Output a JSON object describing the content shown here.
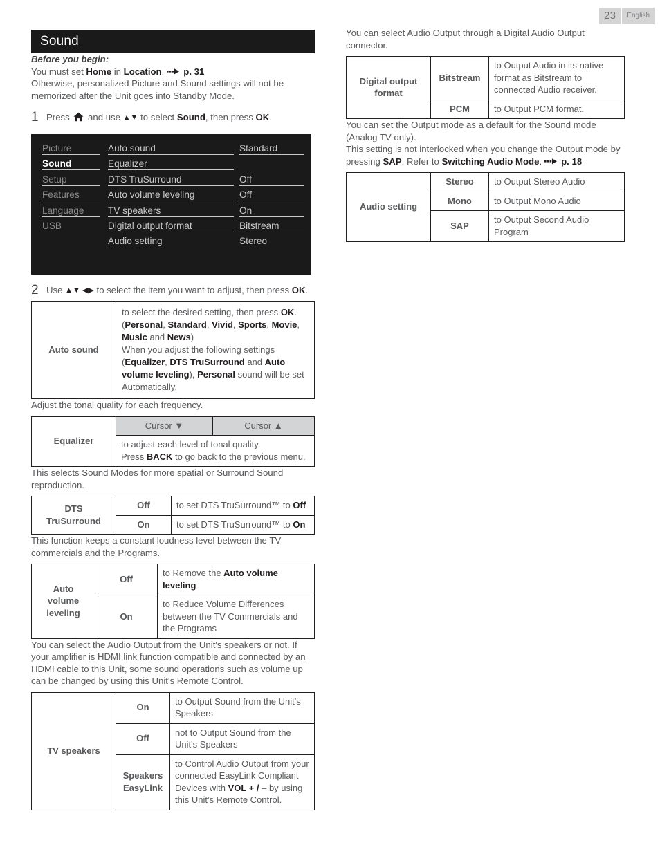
{
  "header": {
    "page_number": "23",
    "language": "English"
  },
  "left": {
    "section_title": "Sound",
    "before_you_begin_label": "Before you begin:",
    "line_home_prefix": "You must set ",
    "line_home_bold1": "Home",
    "line_home_mid": " in ",
    "line_home_bold2": "Location",
    "line_home_dot": ".",
    "line_home_ref": "p. 31",
    "otherwise": "Otherwise, personalized Picture and Sound settings will not be memorized after the Unit goes into Standby Mode.",
    "step1": {
      "number": "1",
      "pre": "Press ",
      "mid": " and use ",
      "arrows": "▲▼",
      "post": " to select ",
      "bold_item": "Sound",
      "tail": ", then press ",
      "bold_ok": "OK",
      "end": "."
    },
    "osd": {
      "menu_items": [
        {
          "label": "Picture",
          "selected": false
        },
        {
          "label": "Sound",
          "selected": true
        },
        {
          "label": "Setup",
          "selected": false
        },
        {
          "label": "Features",
          "selected": false
        },
        {
          "label": "Language",
          "selected": false
        },
        {
          "label": "USB",
          "selected": false
        }
      ],
      "settings": [
        {
          "name": "Auto sound",
          "value": "Standard"
        },
        {
          "name": "Equalizer",
          "value": ""
        },
        {
          "name": "DTS TruSurround",
          "value": "Off"
        },
        {
          "name": "Auto volume leveling",
          "value": "Off"
        },
        {
          "name": "TV speakers",
          "value": "On"
        },
        {
          "name": "Digital output format",
          "value": "Bitstream"
        },
        {
          "name": "Audio setting",
          "value": "Stereo"
        }
      ]
    },
    "step2": {
      "number": "2",
      "pre": "Use ",
      "arrows": "▲▼ ◀▶",
      "post": " to select the item you want to adjust, then press ",
      "bold_ok": "OK",
      "end": "."
    },
    "auto_sound": {
      "key": "Auto sound",
      "l1_pre": "to select the desired setting, then press ",
      "l1_bold": "OK",
      "l1_end": ".",
      "l2": "(Personal, Standard, Vivid, Sports, Movie, Music and News)",
      "l2_open": "(",
      "l2_items": [
        "Personal",
        "Standard",
        "Vivid",
        "Sports",
        "Movie",
        "Music"
      ],
      "l2_and": "and ",
      "l2_last": "News",
      "l2_close": ")",
      "l3": "When you adjust the following settings",
      "l4_open": "(",
      "l4_a": "Equalizer",
      "l4_b": "DTS TruSurround",
      "l4_and": " and ",
      "l4_c": "Auto volume leveling",
      "l4_close": "), ",
      "l4_d": "Personal",
      "l4_tail": " sound will be set",
      "l5": "Automatically."
    },
    "equalizer": {
      "intro": "Adjust the tonal quality for each frequency.",
      "key": "Equalizer",
      "header_down": "Cursor ▼",
      "header_up": "Cursor ▲",
      "desc_l1": "to adjust each level of tonal quality.",
      "desc_l2_pre": "Press ",
      "desc_l2_bold": "BACK",
      "desc_l2_post": " to go back to the previous menu."
    },
    "dts": {
      "intro": "This selects Sound Modes for more spatial or Surround Sound reproduction.",
      "key": "DTS TruSurround",
      "rows": [
        {
          "opt": "Off",
          "desc_pre": "to set DTS TruSurround™ to ",
          "desc_bold": "Off"
        },
        {
          "opt": "On",
          "desc_pre": "to set DTS TruSurround™ to ",
          "desc_bold": "On"
        }
      ]
    },
    "avl": {
      "intro": "This function keeps a constant loudness level between the TV commercials and the Programs.",
      "key": "Auto volume leveling",
      "rows": [
        {
          "opt": "Off",
          "desc_pre": "to Remove the ",
          "desc_bold": "Auto volume leveling",
          "desc_post": ""
        },
        {
          "opt": "On",
          "desc_pre": "to Reduce Volume Differences between the TV Commercials and the Programs",
          "desc_bold": "",
          "desc_post": ""
        }
      ]
    },
    "tvspk": {
      "intro": "You can select the Audio Output from the Unit's speakers or not. If your amplifier is HDMI link function compatible and connected by an HDMI cable to this Unit, some sound operations such as volume up can be changed by using this Unit's Remote Control.",
      "key": "TV speakers",
      "rows": [
        {
          "opt": "On",
          "desc": "to Output Sound from the Unit's Speakers"
        },
        {
          "opt": "Off",
          "desc": "not to Output Sound from the Unit's Speakers"
        },
        {
          "opt": "Speakers EasyLink",
          "desc_pre": "to Control Audio Output from your connected EasyLink Compliant Devices with ",
          "desc_bold": "VOL + /",
          "desc_post": " – by using this Unit's Remote Control."
        }
      ]
    }
  },
  "right": {
    "digital_intro": "You can select Audio Output through a Digital Audio Output connector.",
    "digital": {
      "key": "Digital output format",
      "rows": [
        {
          "opt": "Bitstream",
          "desc": "to Output Audio in its native format as Bitstream to connected Audio receiver."
        },
        {
          "opt": "PCM",
          "desc": "to Output PCM format."
        }
      ]
    },
    "audio_intro1": "You can set the Output mode as a default for the Sound mode (Analog TV only).",
    "audio_intro2_pre": "This setting is not interlocked when you change the Output mode by pressing ",
    "audio_intro2_bold1": "SAP",
    "audio_intro2_mid": ". Refer to ",
    "audio_intro2_bold2": "Switching Audio Mode",
    "audio_intro2_dot": ".",
    "audio_intro2_ref": "p. 18",
    "audio_setting": {
      "key": "Audio setting",
      "rows": [
        {
          "opt": "Stereo",
          "desc": "to Output Stereo Audio"
        },
        {
          "opt": "Mono",
          "desc": "to Output Mono Audio"
        },
        {
          "opt": "SAP",
          "desc": "to Output Second Audio Program"
        }
      ]
    }
  },
  "icons": {
    "home": "home-icon",
    "arrow_ref": "dashed-arrow-icon"
  },
  "colors": {
    "title_bar": "#1a1a1a",
    "badge": "#d4d4d4",
    "table_border": "#231f20",
    "shade": "#d3d4d6",
    "body_text": "#58595b"
  }
}
